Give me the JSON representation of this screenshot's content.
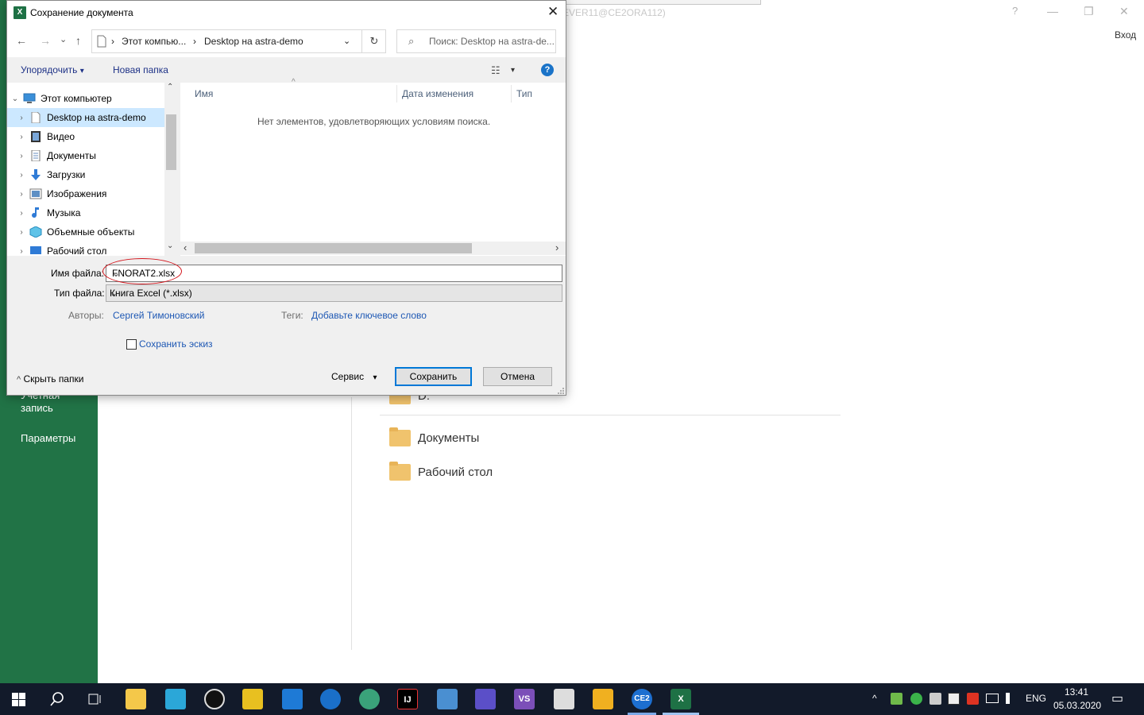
{
  "backstage": {
    "window_title": "EVER11@CE2ORA112)",
    "help_btn": "?",
    "min_btn": "—",
    "max_btn": "❐",
    "close_btn": "✕",
    "login": "Вход",
    "sidebar_account_line1": "Учетная",
    "sidebar_account_line2": "запись",
    "sidebar_params": "Параметры",
    "partial_item": "D:",
    "folders": [
      {
        "label": "Документы"
      },
      {
        "label": "Рабочий стол"
      }
    ],
    "accent": "#217346"
  },
  "dialog": {
    "title": "Сохранение документа",
    "app_icon_letter": "X",
    "close": "✕",
    "nav": {
      "back": "←",
      "forward": "→",
      "recent": "⌄",
      "up": "↑",
      "breadcrumb_root": "Этот компью...",
      "breadcrumb_sep": "›",
      "breadcrumb_current": "Desktop на astra-demo",
      "breadcrumb_dropdown": "⌄",
      "refresh": "↻",
      "search_placeholder": "Поиск: Desktop на astra-de...",
      "search_icon": "⌕"
    },
    "commands": {
      "organize": "Упорядочить",
      "organize_arrow": "▾",
      "new_folder": "Новая папка",
      "view_icon": "☷",
      "view_arrow": "▾",
      "help": "?"
    },
    "tree": [
      {
        "label": "Этот компьютер",
        "expanded": true,
        "level": 0,
        "icon": "computer-icon",
        "arrow": "⌄"
      },
      {
        "label": "Desktop на astra-demo",
        "selected": true,
        "level": 1,
        "icon": "document-icon",
        "arrow": "›"
      },
      {
        "label": "Видео",
        "level": 1,
        "icon": "video-icon",
        "arrow": "›"
      },
      {
        "label": "Документы",
        "level": 1,
        "icon": "documents-icon",
        "arrow": "›"
      },
      {
        "label": "Загрузки",
        "level": 1,
        "icon": "downloads-icon",
        "arrow": "›"
      },
      {
        "label": "Изображения",
        "level": 1,
        "icon": "pictures-icon",
        "arrow": "›"
      },
      {
        "label": "Музыка",
        "level": 1,
        "icon": "music-icon",
        "arrow": "›"
      },
      {
        "label": "Объемные объекты",
        "level": 1,
        "icon": "3d-objects-icon",
        "arrow": "›"
      },
      {
        "label": "Рабочий стол",
        "level": 1,
        "icon": "desktop-icon",
        "arrow": "›"
      }
    ],
    "tree_scroll_up": "⌃",
    "tree_scroll_down": "⌄",
    "columns": {
      "name": "Имя",
      "date": "Дата изменения",
      "type": "Тип",
      "sort_indicator": "^"
    },
    "empty_message": "Нет элементов, удовлетворяющих условиям поиска.",
    "hscroll_left": "‹",
    "hscroll_right": "›",
    "filename_label": "Имя файла:",
    "filename_value": "FNORAT2.xlsx",
    "filetype_label": "Тип файла:",
    "filetype_value": "Книга Excel (*.xlsx)",
    "dropdown_arrow": "⌄",
    "authors_label": "Авторы:",
    "authors_value": "Сергей Тимоновский",
    "tags_label": "Теги:",
    "tags_value": "Добавьте ключевое слово",
    "save_thumbnail": "Сохранить эскиз",
    "hide_folders": "Скрыть папки",
    "hide_folders_icon": "^",
    "service": "Сервис",
    "service_arrow": "▾",
    "save": "Сохранить",
    "cancel": "Отмена",
    "highlight_color": "#d4171e"
  },
  "taskbar": {
    "start_icon": "windows-logo-icon",
    "lang": "ENG",
    "time": "13:41",
    "date": "05.03.2020",
    "tray_chevron": "^",
    "icons": [
      "search-icon",
      "task-view-icon",
      "file-explorer-icon",
      "app-icon",
      "circle-app-icon",
      "batman-icon",
      "maxthon-icon",
      "edge-icon",
      "maps-icon",
      "intellij-icon",
      "pc-icon",
      "save-app-icon",
      "visual-studio-icon",
      "calendar-app-icon",
      "runner-app-icon",
      "ce2-icon",
      "excel-icon"
    ],
    "ce2_label": "CE2",
    "ij_label": "IJ",
    "vs_label": "VS",
    "xl_label": "X",
    "notify_icon": "▭"
  }
}
